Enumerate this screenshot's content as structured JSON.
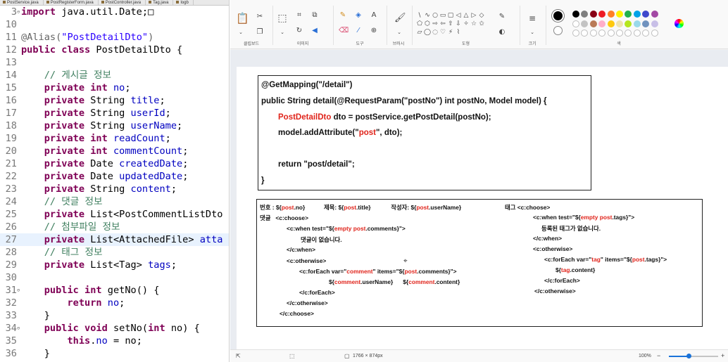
{
  "editor": {
    "tabs": [
      "PostService.java",
      "PostRegisterForm.java",
      "PostController.java",
      "Tag.java",
      "logb"
    ],
    "lines": [
      {
        "n": "3",
        "fold": "⊖",
        "hl": false,
        "tokens": [
          {
            "t": "import",
            "c": "kw"
          },
          {
            "t": " java.util.Date;",
            "c": "tx"
          },
          {
            "t": "□",
            "c": "tx"
          }
        ]
      },
      {
        "n": "10",
        "fold": "",
        "hl": false,
        "tokens": []
      },
      {
        "n": "11",
        "fold": "",
        "hl": false,
        "tokens": [
          {
            "t": "@Alias(",
            "c": "an"
          },
          {
            "t": "\"PostDetailDto\"",
            "c": "st"
          },
          {
            "t": ")",
            "c": "an"
          }
        ]
      },
      {
        "n": "12",
        "fold": "",
        "hl": false,
        "tokens": [
          {
            "t": "public",
            "c": "kw"
          },
          {
            "t": " ",
            "c": "tx"
          },
          {
            "t": "class",
            "c": "kw"
          },
          {
            "t": " PostDetailDto {",
            "c": "tx"
          }
        ]
      },
      {
        "n": "13",
        "fold": "",
        "hl": false,
        "tokens": []
      },
      {
        "n": "14",
        "fold": "",
        "hl": false,
        "tokens": [
          {
            "t": "    // 게시글 정보",
            "c": "cm"
          }
        ]
      },
      {
        "n": "15",
        "fold": "",
        "hl": false,
        "tokens": [
          {
            "t": "    ",
            "c": "tx"
          },
          {
            "t": "private",
            "c": "kw"
          },
          {
            "t": " ",
            "c": "tx"
          },
          {
            "t": "int",
            "c": "kw"
          },
          {
            "t": " ",
            "c": "tx"
          },
          {
            "t": "no",
            "c": "fld"
          },
          {
            "t": ";",
            "c": "tx"
          }
        ]
      },
      {
        "n": "16",
        "fold": "",
        "hl": false,
        "tokens": [
          {
            "t": "    ",
            "c": "tx"
          },
          {
            "t": "private",
            "c": "kw"
          },
          {
            "t": " String ",
            "c": "tx"
          },
          {
            "t": "title",
            "c": "fld"
          },
          {
            "t": ";",
            "c": "tx"
          }
        ]
      },
      {
        "n": "17",
        "fold": "",
        "hl": false,
        "tokens": [
          {
            "t": "    ",
            "c": "tx"
          },
          {
            "t": "private",
            "c": "kw"
          },
          {
            "t": " String ",
            "c": "tx"
          },
          {
            "t": "userId",
            "c": "fld"
          },
          {
            "t": ";",
            "c": "tx"
          }
        ]
      },
      {
        "n": "18",
        "fold": "",
        "hl": false,
        "tokens": [
          {
            "t": "    ",
            "c": "tx"
          },
          {
            "t": "private",
            "c": "kw"
          },
          {
            "t": " String ",
            "c": "tx"
          },
          {
            "t": "userName",
            "c": "fld"
          },
          {
            "t": ";",
            "c": "tx"
          }
        ]
      },
      {
        "n": "19",
        "fold": "",
        "hl": false,
        "tokens": [
          {
            "t": "    ",
            "c": "tx"
          },
          {
            "t": "private",
            "c": "kw"
          },
          {
            "t": " ",
            "c": "tx"
          },
          {
            "t": "int",
            "c": "kw"
          },
          {
            "t": " ",
            "c": "tx"
          },
          {
            "t": "readCount",
            "c": "fld"
          },
          {
            "t": ";",
            "c": "tx"
          }
        ]
      },
      {
        "n": "20",
        "fold": "",
        "hl": false,
        "tokens": [
          {
            "t": "    ",
            "c": "tx"
          },
          {
            "t": "private",
            "c": "kw"
          },
          {
            "t": " ",
            "c": "tx"
          },
          {
            "t": "int",
            "c": "kw"
          },
          {
            "t": " ",
            "c": "tx"
          },
          {
            "t": "commentCount",
            "c": "fld"
          },
          {
            "t": ";",
            "c": "tx"
          }
        ]
      },
      {
        "n": "21",
        "fold": "",
        "hl": false,
        "tokens": [
          {
            "t": "    ",
            "c": "tx"
          },
          {
            "t": "private",
            "c": "kw"
          },
          {
            "t": " Date ",
            "c": "tx"
          },
          {
            "t": "createdDate",
            "c": "fld"
          },
          {
            "t": ";",
            "c": "tx"
          }
        ]
      },
      {
        "n": "22",
        "fold": "",
        "hl": false,
        "tokens": [
          {
            "t": "    ",
            "c": "tx"
          },
          {
            "t": "private",
            "c": "kw"
          },
          {
            "t": " Date ",
            "c": "tx"
          },
          {
            "t": "updatedDate",
            "c": "fld"
          },
          {
            "t": ";",
            "c": "tx"
          }
        ]
      },
      {
        "n": "23",
        "fold": "",
        "hl": false,
        "tokens": [
          {
            "t": "    ",
            "c": "tx"
          },
          {
            "t": "private",
            "c": "kw"
          },
          {
            "t": " String ",
            "c": "tx"
          },
          {
            "t": "content",
            "c": "fld"
          },
          {
            "t": ";",
            "c": "tx"
          }
        ]
      },
      {
        "n": "24",
        "fold": "",
        "hl": false,
        "tokens": [
          {
            "t": "    // 댓글 정보",
            "c": "cm"
          }
        ]
      },
      {
        "n": "25",
        "fold": "",
        "hl": false,
        "tokens": [
          {
            "t": "    ",
            "c": "tx"
          },
          {
            "t": "private",
            "c": "kw"
          },
          {
            "t": " List<PostCommentListDto",
            "c": "tx"
          }
        ]
      },
      {
        "n": "26",
        "fold": "",
        "hl": false,
        "tokens": [
          {
            "t": "    // 첨부파일 정보",
            "c": "cm"
          }
        ]
      },
      {
        "n": "27",
        "fold": "",
        "hl": true,
        "tokens": [
          {
            "t": "    ",
            "c": "tx"
          },
          {
            "t": "private",
            "c": "kw"
          },
          {
            "t": " List<AttachedFile> ",
            "c": "tx"
          },
          {
            "t": "atta",
            "c": "fld"
          }
        ]
      },
      {
        "n": "28",
        "fold": "",
        "hl": false,
        "tokens": [
          {
            "t": "    // 태그 정보",
            "c": "cm"
          }
        ]
      },
      {
        "n": "29",
        "fold": "",
        "hl": false,
        "tokens": [
          {
            "t": "    ",
            "c": "tx"
          },
          {
            "t": "private",
            "c": "kw"
          },
          {
            "t": " List<Tag> ",
            "c": "tx"
          },
          {
            "t": "tags",
            "c": "fld"
          },
          {
            "t": ";",
            "c": "tx"
          }
        ]
      },
      {
        "n": "30",
        "fold": "",
        "hl": false,
        "tokens": []
      },
      {
        "n": "31",
        "fold": "⊖",
        "hl": false,
        "tokens": [
          {
            "t": "    ",
            "c": "tx"
          },
          {
            "t": "public",
            "c": "kw"
          },
          {
            "t": " ",
            "c": "tx"
          },
          {
            "t": "int",
            "c": "kw"
          },
          {
            "t": " getNo() {",
            "c": "tx"
          }
        ]
      },
      {
        "n": "32",
        "fold": "",
        "hl": false,
        "tokens": [
          {
            "t": "        ",
            "c": "tx"
          },
          {
            "t": "return",
            "c": "kw"
          },
          {
            "t": " ",
            "c": "tx"
          },
          {
            "t": "no",
            "c": "fld"
          },
          {
            "t": ";",
            "c": "tx"
          }
        ]
      },
      {
        "n": "33",
        "fold": "",
        "hl": false,
        "tokens": [
          {
            "t": "    }",
            "c": "tx"
          }
        ]
      },
      {
        "n": "34",
        "fold": "⊖",
        "hl": false,
        "tokens": [
          {
            "t": "    ",
            "c": "tx"
          },
          {
            "t": "public",
            "c": "kw"
          },
          {
            "t": " ",
            "c": "tx"
          },
          {
            "t": "void",
            "c": "kw"
          },
          {
            "t": " setNo(",
            "c": "tx"
          },
          {
            "t": "int",
            "c": "kw"
          },
          {
            "t": " no) {",
            "c": "tx"
          }
        ]
      },
      {
        "n": "35",
        "fold": "",
        "hl": false,
        "tokens": [
          {
            "t": "        ",
            "c": "tx"
          },
          {
            "t": "this",
            "c": "kw"
          },
          {
            "t": ".",
            "c": "tx"
          },
          {
            "t": "no",
            "c": "fld"
          },
          {
            "t": " = no;",
            "c": "tx"
          }
        ]
      },
      {
        "n": "36",
        "fold": "",
        "hl": false,
        "tokens": [
          {
            "t": "    }",
            "c": "tx"
          }
        ]
      }
    ]
  },
  "ribbon": {
    "groups": {
      "clipboard": "클립보드",
      "image": "이미지",
      "tools": "도구",
      "brushes": "브러시",
      "shapes": "도형",
      "size": "크기",
      "colors": "색"
    },
    "palette": [
      "#000000",
      "#7f7f7f",
      "#880015",
      "#ed1c24",
      "#ff7f27",
      "#fff200",
      "#22b14c",
      "#00a2e8",
      "#3f48cc",
      "#a349a4",
      "#ffffff",
      "#c3c3c3",
      "#b97a57",
      "#ffaec9",
      "#ffc90e",
      "#efe4b0",
      "#b5e61d",
      "#99d9ea",
      "#7092be",
      "#c8bfe7"
    ]
  },
  "box1": {
    "l1": "@GetMapping(\"/detail\")",
    "l2": "public String detail(@RequestParam(\"postNo\") int postNo, Model model) {",
    "l3a": "PostDetailDto",
    "l3b": " dto = postService.getPostDetail(postNo);",
    "l4a": "model.addAttribute(\"",
    "l4b": "post",
    "l4c": "\", dto);",
    "l5": "return \"post/detail\";",
    "l6": "}"
  },
  "box2": {
    "r1a": "번호 : ${",
    "r1b": "post",
    "r1c": ".no}",
    "r1d": "제목: ${",
    "r1e": "post",
    "r1f": ".title}",
    "r1g": "작성자: ${",
    "r1h": "post",
    "r1i": ".userName}",
    "r2a": "댓글",
    "r2b": "<c:choose>",
    "r3a": "<c:when test=\"${",
    "r3b": "empty post",
    "r3c": ".comments}\">",
    "r4": "댓글이 없습니다.",
    "r5": "</c:when>",
    "r6": "<c:otherwise>",
    "r7a": "<c:forEach var=\"",
    "r7b": "comment",
    "r7c": "\" items=\"${",
    "r7d": "post",
    "r7e": ".comments}\">",
    "r8a": "${",
    "r8b": "comment",
    "r8c": ".userName}",
    "r8d": "${",
    "r8e": "comment",
    "r8f": ".content}",
    "r9": "</c:forEach>",
    "r10": "</c:otherwise>",
    "r11": "</c:choose>",
    "t1": "태그 <c:choose>",
    "t2a": "<c:when test=\"${",
    "t2b": "empty post",
    "t2c": ".tags}\">",
    "t3": "등록된 태그가 없습니다.",
    "t4": "</c:when>",
    "t5": "<c:otherwise>",
    "t6a": "<c:forEach var=\"",
    "t6b": "tag",
    "t6c": "\" items=\"${",
    "t6d": "post",
    "t6e": ".tags}\">",
    "t7a": "${",
    "t7b": "tag",
    "t7c": ".content}",
    "t8": "</c:forEach>",
    "t9": "</c:otherwise>"
  },
  "status": {
    "dimensions": "1766 × 874px",
    "zoom": "100%",
    "zoom_fraction": 0.4
  }
}
